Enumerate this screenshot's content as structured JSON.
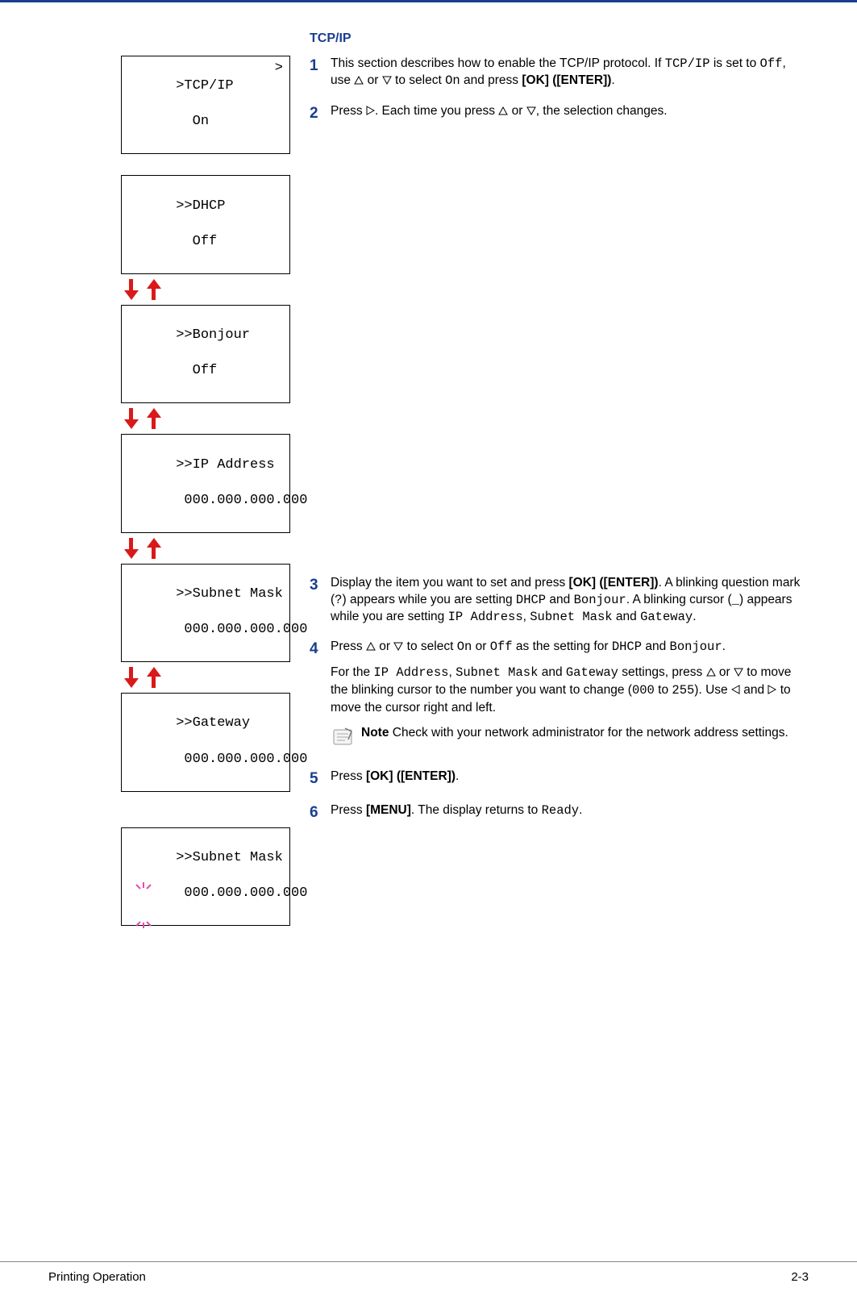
{
  "title": "TCP/IP",
  "lcd": {
    "tcpip": {
      "line1": ">TCP/IP",
      "line2": "  On",
      "chevron": ">"
    },
    "dhcp": {
      "line1": ">>DHCP",
      "line2": "  Off"
    },
    "bonjour": {
      "line1": ">>Bonjour",
      "line2": "  Off"
    },
    "ip": {
      "line1": ">>IP Address",
      "line2": " 000.000.000.000"
    },
    "subnet": {
      "line1": ">>Subnet Mask",
      "line2": " 000.000.000.000"
    },
    "gateway": {
      "line1": ">>Gateway",
      "line2": " 000.000.000.000"
    },
    "subnet_edit": {
      "line1": ">>Subnet Mask",
      "line2": " 000.000.000.000"
    }
  },
  "steps": {
    "s1": {
      "num": "1",
      "t1": "This section describes how to enable the TCP/IP protocol. If ",
      "c1": "TCP/IP",
      "t2": " is set to ",
      "c2": "Off",
      "t3": ", use ",
      "t4": " or ",
      "t5": " to select ",
      "c3": "On",
      "t6": " and press ",
      "b1": "[OK] ([ENTER])",
      "t7": "."
    },
    "s2": {
      "num": "2",
      "t1": "Press ",
      "t2": ".  Each time you press ",
      "t3": " or ",
      "t4": ", the selection changes."
    },
    "s3": {
      "num": "3",
      "t1": "Display the item you want to set and press ",
      "b1": "[OK] ([ENTER])",
      "t2": ". A blinking question mark (",
      "c1": "?",
      "t3": ") appears while you are setting ",
      "c2": "DHCP",
      "t4": " and ",
      "c3": "Bonjour",
      "t5": ". A blinking cursor (",
      "c4": "_",
      "t6": ") appears while you are setting ",
      "c5": "IP Address",
      "t7": ", ",
      "c6": "Subnet Mask",
      "t8": " and ",
      "c7": "Gateway",
      "t9": "."
    },
    "s4": {
      "num": "4",
      "p1_t1": "Press ",
      "p1_t2": " or ",
      "p1_t3": " to select ",
      "p1_c1": "On",
      "p1_t4": " or ",
      "p1_c2": "Off",
      "p1_t5": " as the setting for ",
      "p1_c3": "DHCP",
      "p1_t6": " and ",
      "p1_c4": "Bonjour",
      "p1_t7": ".",
      "p2_t1": "For the ",
      "p2_c1": "IP Address",
      "p2_t2": ", ",
      "p2_c2": "Subnet Mask",
      "p2_t3": " and ",
      "p2_c3": "Gateway",
      "p2_t4": " settings, press ",
      "p2_t5": " or ",
      "p2_t6": " to move the blinking cursor to the number you want to change (",
      "p2_c4": "000",
      "p2_t7": " to ",
      "p2_c5": "255",
      "p2_t8": "). Use ",
      "p2_t9": " and ",
      "p2_t10": " to move the cursor right and left.",
      "note_label": "Note",
      "note_text": "  Check with your network administrator for the network address settings."
    },
    "s5": {
      "num": "5",
      "t1": "Press ",
      "b1": "[OK] ([ENTER])",
      "t2": "."
    },
    "s6": {
      "num": "6",
      "t1": "Press ",
      "b1": "[MENU]",
      "t2": ".  The display returns to ",
      "c1": "Ready",
      "t3": "."
    }
  },
  "footer": {
    "left": "Printing Operation",
    "right": "2-3"
  }
}
